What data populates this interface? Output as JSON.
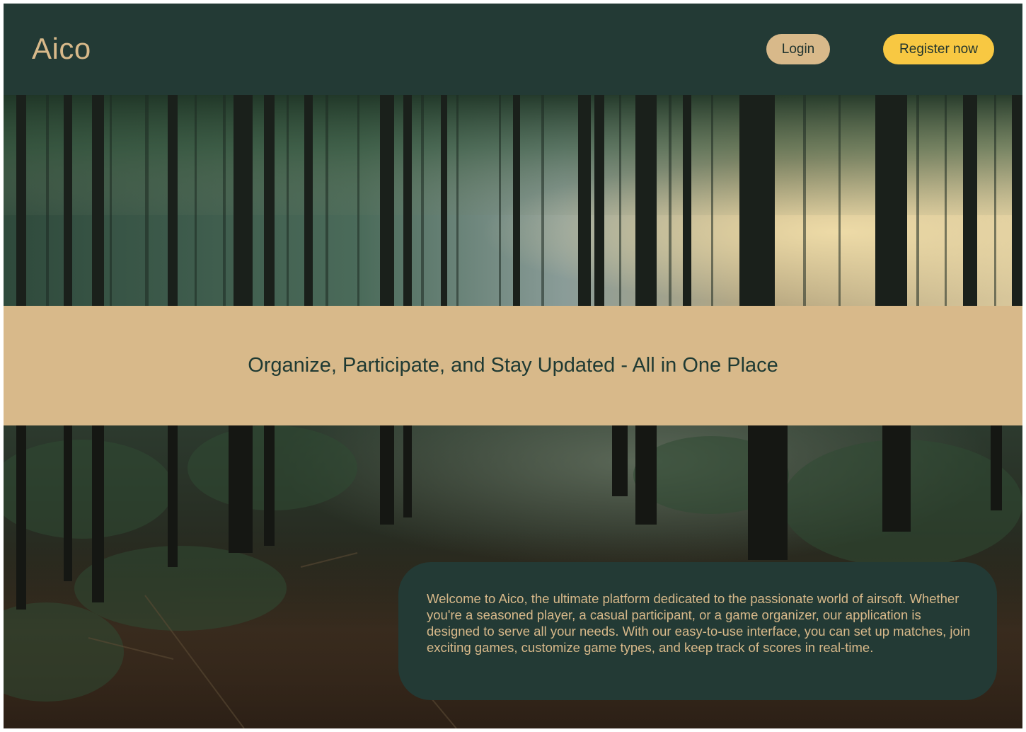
{
  "header": {
    "logo": "Aico",
    "login_label": "Login",
    "register_label": "Register now"
  },
  "hero": {
    "tagline": "Organize, Participate, and Stay Updated - All in One Place"
  },
  "welcome": {
    "text": "Welcome to Aico, the ultimate platform dedicated to the passionate world of airsoft. Whether you're a seasoned player, a casual participant, or a game organizer, our application is designed to serve all your needs. With our easy-to-use interface, you can set up matches, join exciting games, customize game types, and keep track of scores in real-time."
  },
  "colors": {
    "header_bg": "#233a35",
    "accent_tan": "#d8b98a",
    "accent_yellow": "#f8c842",
    "text_dark": "#1f332e"
  }
}
